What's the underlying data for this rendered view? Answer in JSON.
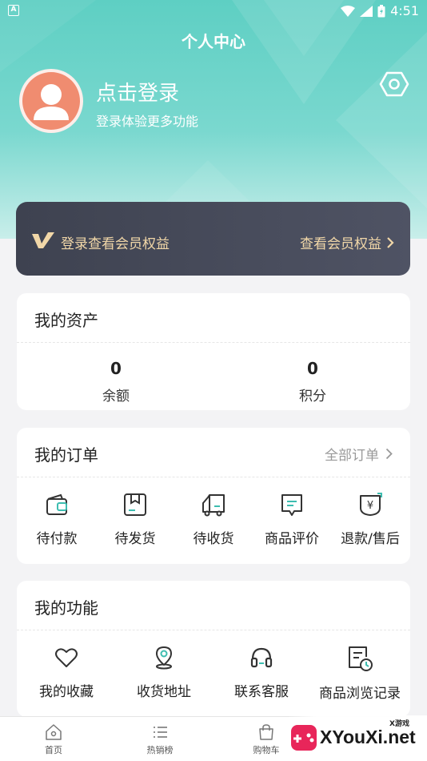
{
  "status_bar": {
    "time": "4:51"
  },
  "header": {
    "title": "个人中心",
    "login_title": "点击登录",
    "login_subtitle": "登录体验更多功能"
  },
  "member_card": {
    "text": "登录查看会员权益",
    "link_label": "查看会员权益"
  },
  "assets": {
    "title": "我的资产",
    "items": [
      {
        "value": "0",
        "label": "余额"
      },
      {
        "value": "0",
        "label": "积分"
      }
    ]
  },
  "orders": {
    "title": "我的订单",
    "more_label": "全部订单",
    "items": [
      {
        "label": "待付款",
        "icon": "wallet-icon"
      },
      {
        "label": "待发货",
        "icon": "package-icon"
      },
      {
        "label": "待收货",
        "icon": "truck-icon"
      },
      {
        "label": "商品评价",
        "icon": "review-icon"
      },
      {
        "label": "退款/售后",
        "icon": "refund-icon"
      }
    ]
  },
  "functions": {
    "title": "我的功能",
    "items": [
      {
        "label": "我的收藏",
        "icon": "heart-icon"
      },
      {
        "label": "收货地址",
        "icon": "location-icon"
      },
      {
        "label": "联系客服",
        "icon": "headset-icon"
      },
      {
        "label": "商品浏览记录",
        "icon": "history-icon"
      }
    ]
  },
  "bottom_nav": {
    "items": [
      {
        "label": "首页",
        "icon": "home-icon"
      },
      {
        "label": "热销榜",
        "icon": "list-icon"
      },
      {
        "label": "购物车",
        "icon": "cart-icon"
      }
    ]
  },
  "watermark": {
    "small": "X游戏",
    "text": "XYouXi.net"
  },
  "colors": {
    "accent": "#5ecfc3",
    "member_card_bg": "#454957",
    "member_gold": "#f1d7a8",
    "avatar_bg": "#f08c70",
    "icon_teal": "#3dbdb0"
  }
}
